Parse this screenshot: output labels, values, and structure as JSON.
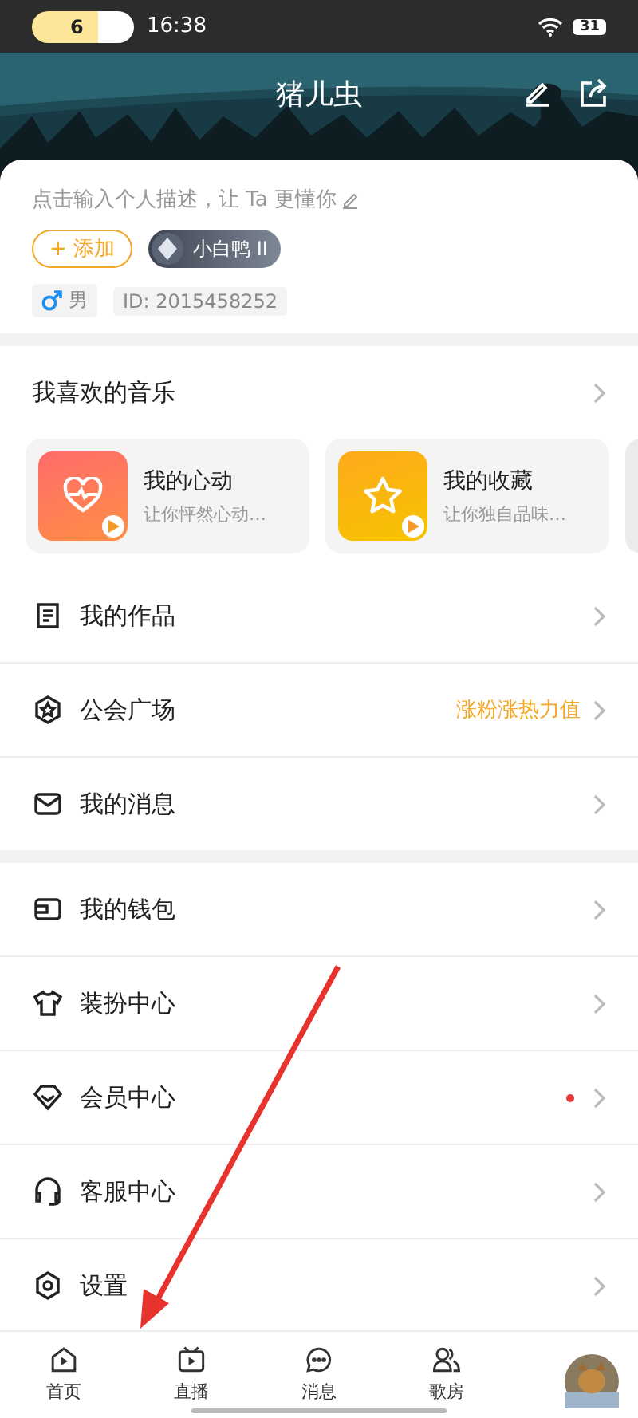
{
  "status_bar": {
    "badge": "6",
    "time": "16:38",
    "battery": "31"
  },
  "header": {
    "title": "猪儿虫"
  },
  "profile": {
    "description": "点击输入个人描述，让 Ta 更懂你",
    "add_button": "+ 添加",
    "level_badge": "小白鸭 II",
    "gender": "男",
    "id": "ID: 2015458252"
  },
  "favorites": {
    "title": "我喜欢的音乐",
    "cards": [
      {
        "kind": "heart",
        "title": "我的心动",
        "subtitle": "让你怦然心动…"
      },
      {
        "kind": "star",
        "title": "我的收藏",
        "subtitle": "让你独自品味…"
      }
    ]
  },
  "menu_groups": [
    [
      {
        "label": "我的作品",
        "dot": false
      },
      {
        "label": "公会广场",
        "note": "涨粉涨热力值",
        "dot": false
      },
      {
        "label": "我的消息",
        "dot": false
      }
    ],
    [
      {
        "label": "我的钱包",
        "dot": false
      },
      {
        "label": "装扮中心",
        "dot": false
      },
      {
        "label": "会员中心",
        "dot": true
      },
      {
        "label": "客服中心",
        "dot": false
      },
      {
        "label": "设置",
        "dot": false
      }
    ]
  ],
  "tab_bar": [
    {
      "label": "首页"
    },
    {
      "label": "直播"
    },
    {
      "label": "消息"
    },
    {
      "label": "歌房"
    }
  ]
}
